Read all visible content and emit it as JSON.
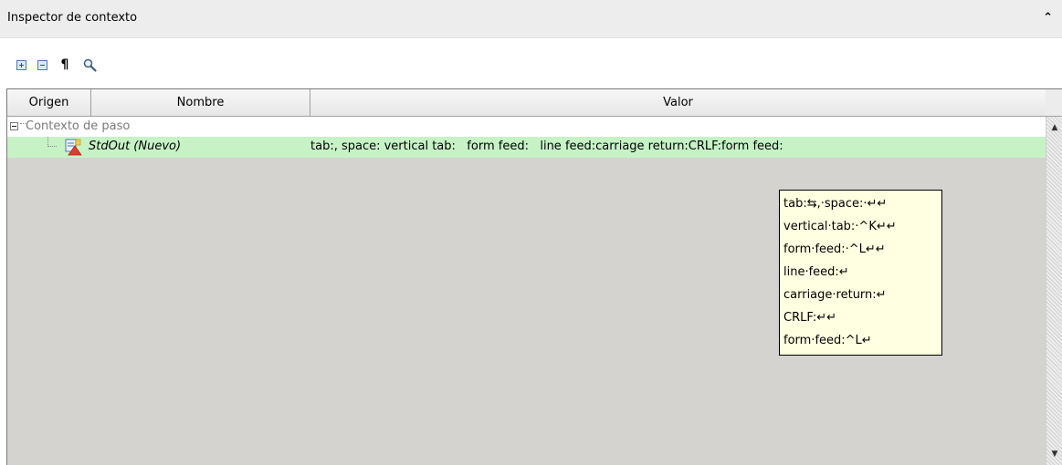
{
  "panel": {
    "title": "Inspector de contexto",
    "collapse_glyph": "⌃"
  },
  "toolbar": {
    "buttons": [
      {
        "name": "expand-all",
        "icon": "plus-box-icon"
      },
      {
        "name": "collapse-all",
        "icon": "minus-box-icon"
      },
      {
        "name": "show-whitespace",
        "icon": "pilcrow-icon",
        "glyph": "¶"
      },
      {
        "name": "search",
        "icon": "magnifier-icon"
      }
    ]
  },
  "grid": {
    "columns": [
      "Origen",
      "Nombre",
      "Valor"
    ],
    "group": {
      "label": "Contexto de paso"
    },
    "rows": [
      {
        "icon": "stdout-icon",
        "name": "StdOut (Nuevo)",
        "value": "tab:, space: vertical tab:   form feed:   line feed:carriage return:CRLF:form feed:"
      }
    ]
  },
  "tooltip": {
    "lines": [
      "tab:⇆,·space:·↵↵",
      "vertical·tab:·^K↵↵",
      "form·feed:·^L↵↵",
      "line·feed:↵",
      "carriage·return:↵",
      "CRLF:↵↵",
      "form·feed:^L↵"
    ]
  },
  "colors": {
    "selected_row": "#c6f2c6",
    "tooltip_bg": "#ffffe1",
    "grid_bg": "#d5d3cf"
  }
}
